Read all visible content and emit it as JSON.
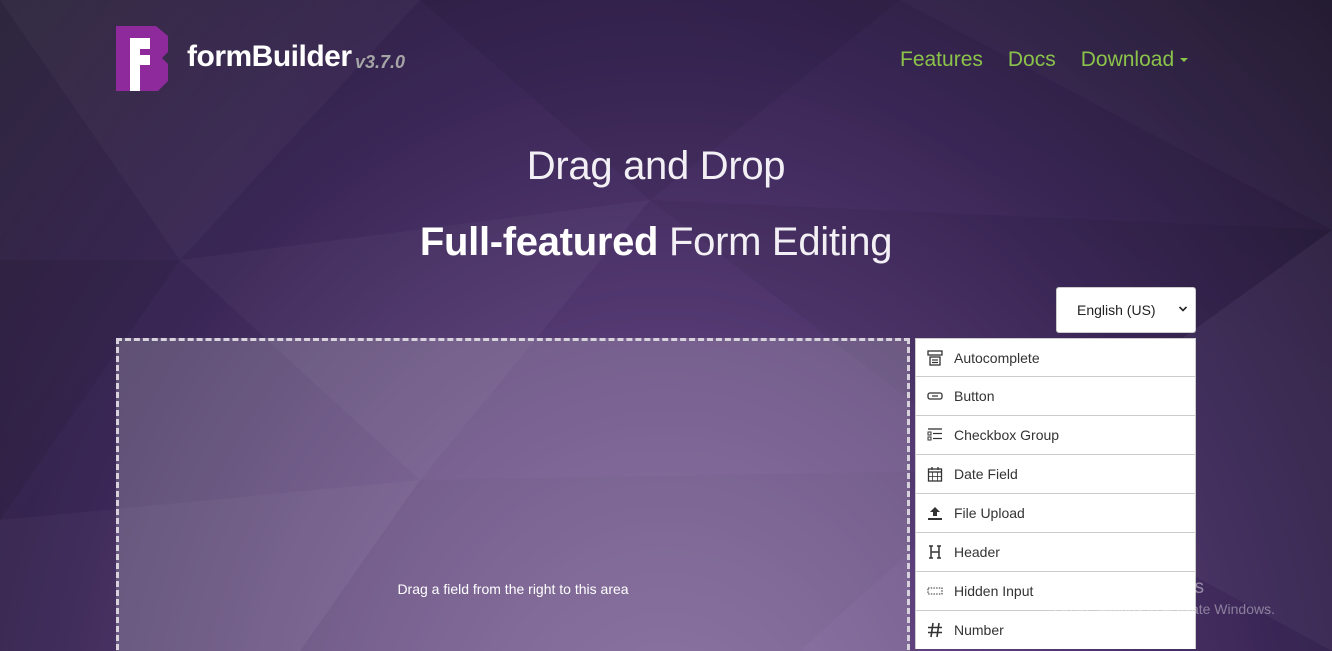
{
  "brand": {
    "name": "formBuilder",
    "version": "v3.7.0"
  },
  "nav": {
    "features": "Features",
    "docs": "Docs",
    "download": "Download"
  },
  "hero": {
    "line1": "Drag and Drop",
    "line2_strong": "Full-featured",
    "line2_rest": " Form Editing"
  },
  "language": {
    "selected": "English (US)"
  },
  "stage": {
    "hint": "Drag a field from the right to this area"
  },
  "controls": [
    {
      "label": "Autocomplete",
      "icon": "autocomplete-icon"
    },
    {
      "label": "Button",
      "icon": "button-icon"
    },
    {
      "label": "Checkbox Group",
      "icon": "checkbox-group-icon"
    },
    {
      "label": "Date Field",
      "icon": "calendar-icon"
    },
    {
      "label": "File Upload",
      "icon": "upload-icon"
    },
    {
      "label": "Header",
      "icon": "header-icon"
    },
    {
      "label": "Hidden Input",
      "icon": "hidden-input-icon"
    },
    {
      "label": "Number",
      "icon": "hash-icon"
    }
  ],
  "watermark": {
    "title": "Activate Windows",
    "subtitle": "Go to Settings to activate Windows."
  },
  "colors": {
    "accent": "#8bc34a",
    "logo": "#8e2a9b",
    "version": "#a5a5a5"
  }
}
